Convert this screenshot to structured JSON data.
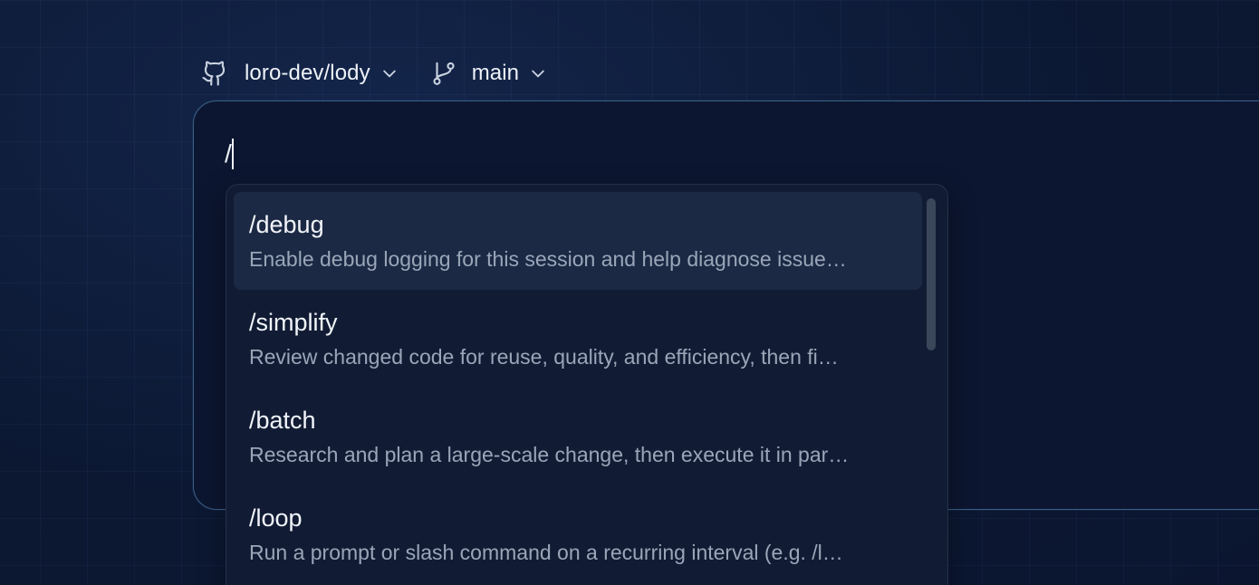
{
  "repo_selector": {
    "icon": "github-icon",
    "label": "loro-dev/lody",
    "chevron_icon": "chevron-down-icon"
  },
  "branch_selector": {
    "icon": "git-branch-icon",
    "label": "main",
    "chevron_icon": "chevron-down-icon"
  },
  "composer": {
    "value": "/"
  },
  "commands": [
    {
      "name": "/debug",
      "description": "Enable debug logging for this session and help diagnose issue…",
      "highlighted": true
    },
    {
      "name": "/simplify",
      "description": "Review changed code for reuse, quality, and efficiency, then fi…",
      "highlighted": false
    },
    {
      "name": "/batch",
      "description": "Research and plan a large-scale change, then execute it in par…",
      "highlighted": false
    },
    {
      "name": "/loop",
      "description": "Run a prompt or slash command on a recurring interval (e.g. /l…",
      "highlighted": false
    }
  ],
  "colors": {
    "background": "#0d1a36",
    "composer_border": "#3b5e86",
    "dropdown_bg": "#111c34",
    "highlight_bg": "#1c2944",
    "text_primary": "#f2f5fa",
    "text_secondary": "#9aa6b8"
  }
}
